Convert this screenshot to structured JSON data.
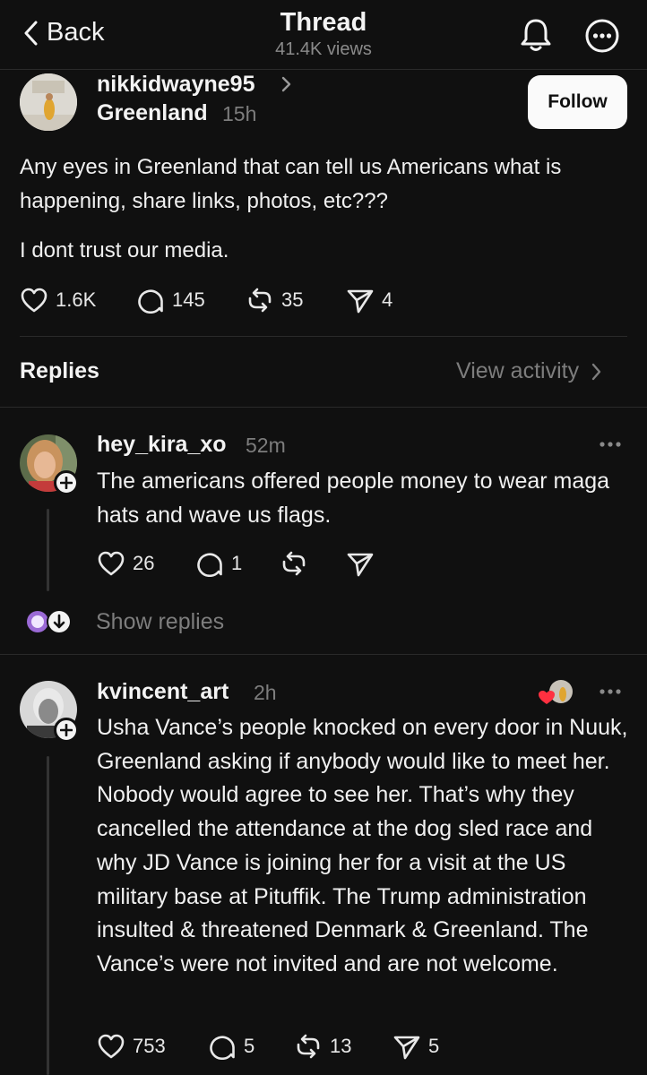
{
  "header": {
    "back_label": "Back",
    "title": "Thread",
    "views": "41.4K views"
  },
  "post": {
    "username": "nikkidwayne95",
    "location": "Greenland",
    "time": "15h",
    "follow_label": "Follow",
    "text_1": "Any eyes in Greenland that can tell us Americans what is happening, share links, photos, etc???",
    "text_2": "I dont trust our media.",
    "likes": "1.6K",
    "comments": "145",
    "reposts": "35",
    "shares": "4"
  },
  "replies_header": {
    "label": "Replies",
    "view_activity": "View activity"
  },
  "replies": [
    {
      "username": "hey_kira_xo",
      "time": "52m",
      "text": "The americans offered people money to wear maga hats and wave us flags.",
      "likes": "26",
      "comments": "1",
      "show_replies": "Show replies"
    },
    {
      "username": "kvincent_art",
      "time": "2h",
      "text": "Usha Vance’s people knocked on every door in Nuuk, Greenland asking if anybody would like to meet her. Nobody would agree to see her. That’s why they cancelled the attendance at the dog sled race and why JD Vance is joining her for a visit at the US military base at Pituffik. The Trump administration insulted & threatened Denmark & Greenland. The Vance’s were not invited and are not welcome.",
      "likes": "753",
      "comments": "5",
      "reposts": "13",
      "shares": "5"
    }
  ],
  "colors": {
    "background": "#101010",
    "text": "#f3f3f3",
    "muted": "#7d7d7d",
    "liked_heart": "#ff3040"
  }
}
